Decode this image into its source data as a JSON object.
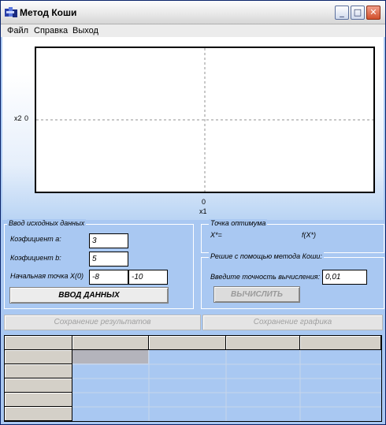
{
  "window": {
    "title": "Метод Коши"
  },
  "menu": {
    "items": [
      {
        "label": "Файл"
      },
      {
        "label": "Справка"
      },
      {
        "label": "Выход"
      }
    ]
  },
  "chart_data": {
    "type": "line",
    "title": "",
    "xlabel": "x1",
    "ylabel": "x2",
    "x_ticks": [
      "0"
    ],
    "y_ticks": [
      "0"
    ],
    "series": [],
    "grid": "dashed center lines"
  },
  "input_group": {
    "title": "Ввод исходных данных",
    "coef_a_label": "Коэфициент а:",
    "coef_a_value": "3",
    "coef_b_label": "Коэфициент b:",
    "coef_b_value": "5",
    "start_point_label": "Начальная точка X(0)",
    "start_x1_value": "-8",
    "start_x2_value": "-10",
    "submit_label": "ВВОД ДАННЫХ"
  },
  "optimum_group": {
    "title": "Точка оптимума",
    "x_star_label": "X*=",
    "f_star_label": "f(X*)"
  },
  "cauchy_group": {
    "title": "Решие с помощью метода Коши:",
    "precision_label": "Введите точность вычисления:",
    "precision_value": "0,01",
    "compute_label": "ВЫЧИСЛИТЬ"
  },
  "actions": {
    "save_results_label": "Сохранение результатов",
    "save_chart_label": "Сохранение графика"
  },
  "colors": {
    "panel": "#a9c8f2",
    "selected_cell": "#b4b4bc"
  }
}
